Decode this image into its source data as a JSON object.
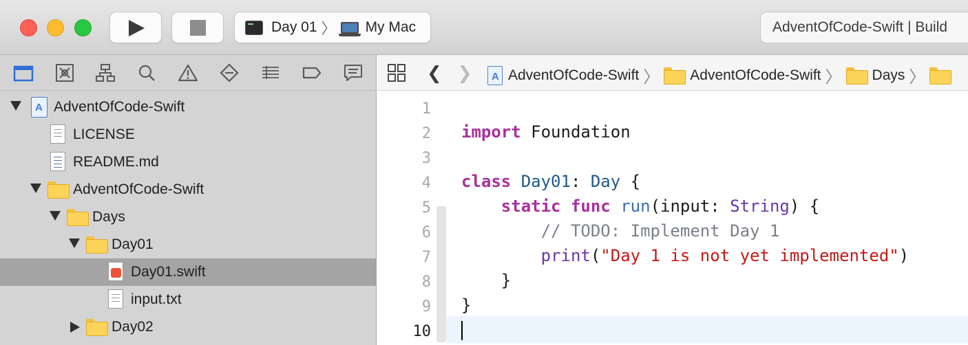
{
  "toolbar": {
    "scheme_target": "Day 01",
    "scheme_destination": "My Mac",
    "activity_text": "AdventOfCode-Swift | Build"
  },
  "navigator": {
    "tabs": [
      "folder-icon",
      "source-control-icon",
      "symbol-icon",
      "search-icon",
      "warning-icon",
      "test-icon",
      "debug-icon",
      "breakpoint-icon",
      "report-icon"
    ],
    "tree": [
      {
        "label": "AdventOfCode-Swift",
        "kind": "project",
        "depth": 0,
        "expanded": true
      },
      {
        "label": "LICENSE",
        "kind": "doc",
        "depth": 1
      },
      {
        "label": "README.md",
        "kind": "markdown",
        "depth": 1
      },
      {
        "label": "AdventOfCode-Swift",
        "kind": "folder",
        "depth": 1,
        "expanded": true
      },
      {
        "label": "Days",
        "kind": "folder",
        "depth": 2,
        "expanded": true
      },
      {
        "label": "Day01",
        "kind": "folder",
        "depth": 3,
        "expanded": true
      },
      {
        "label": "Day01.swift",
        "kind": "swift",
        "depth": 4,
        "selected": true
      },
      {
        "label": "input.txt",
        "kind": "doc",
        "depth": 4
      },
      {
        "label": "Day02",
        "kind": "folder",
        "depth": 3,
        "expanded": false
      }
    ]
  },
  "editor": {
    "breadcrumbs": [
      "AdventOfCode-Swift",
      "AdventOfCode-Swift",
      "Days"
    ],
    "line_numbers": [
      "1",
      "2",
      "3",
      "4",
      "5",
      "6",
      "7",
      "8",
      "9",
      "10"
    ],
    "current_line": "10",
    "code": {
      "l2_kw": "import",
      "l2_rest": " Foundation",
      "l4_kw": "class",
      "l4_name": "Day01",
      "l4_colon": ": ",
      "l4_super": "Day",
      "l4_brace": " {",
      "l5_kw1": "static",
      "l5_kw2": "func",
      "l5_fn": "run",
      "l5_params": "(input: ",
      "l5_type": "String",
      "l5_end": ") {",
      "l6_comment": "// TODO: Implement Day 1",
      "l7_fn": "print",
      "l7_open": "(",
      "l7_str": "\"Day 1 is not yet implemented\"",
      "l7_close": ")",
      "l8_brace": "}",
      "l9_brace": "}"
    }
  },
  "colors": {
    "keyword": "#a9309c",
    "type": "#1f5a8e",
    "comment": "#7b8088",
    "string": "#c41a16",
    "selection": "#a4a4a4"
  }
}
